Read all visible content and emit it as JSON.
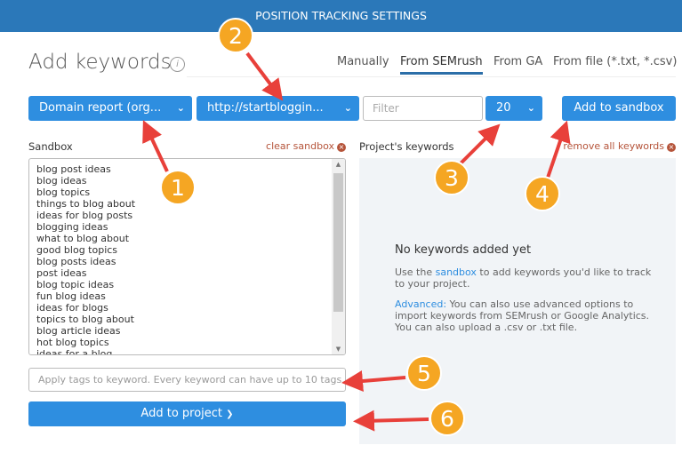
{
  "header": {
    "title": "POSITION TRACKING SETTINGS"
  },
  "page": {
    "title": "Add keywords",
    "info_icon": "i"
  },
  "tabs": [
    {
      "label": "Manually"
    },
    {
      "label": "From SEMrush",
      "active": true
    },
    {
      "label": "From GA"
    },
    {
      "label": "From file (*.txt, *.csv)"
    }
  ],
  "controls": {
    "source": "Domain report (org...",
    "domain": "http://startbloggin...",
    "filter_placeholder": "Filter",
    "count": "20",
    "add_sandbox": "Add to sandbox",
    "chevron": "❯"
  },
  "sandbox": {
    "label": "Sandbox",
    "clear": "clear sandbox",
    "keywords": [
      "blog post ideas",
      "blog ideas",
      "blog topics",
      "things to blog about",
      "ideas for blog posts",
      "blogging ideas",
      "what to blog about",
      "good blog topics",
      "blog posts ideas",
      "post ideas",
      "blog topic ideas",
      "fun blog ideas",
      "ideas for blogs",
      "topics to blog about",
      "blog article ideas",
      "hot blog topics",
      "ideas for a blog"
    ]
  },
  "project": {
    "label": "Project's keywords",
    "remove": "remove all keywords",
    "empty_title": "No keywords added yet",
    "p1_pre": "Use the ",
    "p1_link": "sandbox",
    "p1_post": " to add keywords you'd like to track to your project.",
    "p2_link": "Advanced:",
    "p2_post": " You can also use advanced options to import keywords from SEMrush or Google Analytics. You can also upload a .csv or .txt file."
  },
  "tags": {
    "placeholder": "Apply tags to keyword. Every keyword can have up to 10 tags."
  },
  "add_project": {
    "label": "Add to project",
    "chevron": "❯"
  },
  "annotations": [
    "1",
    "2",
    "3",
    "4",
    "5",
    "6"
  ],
  "colors": {
    "header": "#2b78b9",
    "button": "#2e8ee0",
    "badge": "#f5a623",
    "arrow": "#e8403a",
    "link": "#b5543a"
  }
}
